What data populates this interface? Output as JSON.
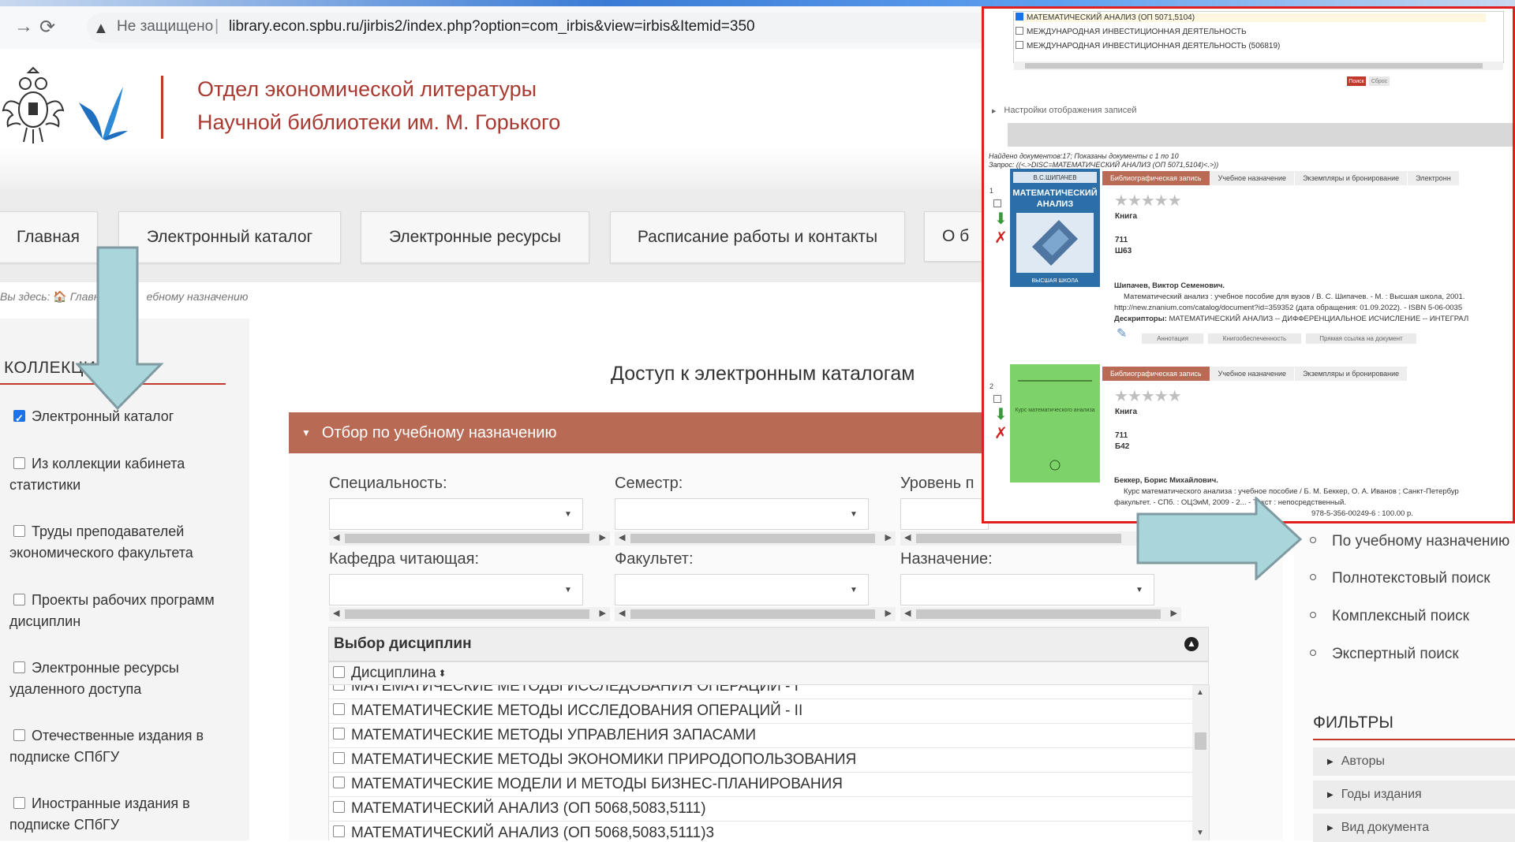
{
  "browser": {
    "insecure_label": "Не защищено",
    "url": "library.econ.spbu.ru/jirbis2/index.php?option=com_irbis&view=irbis&Itemid=350",
    "back_icon": "arrow-forward-icon",
    "reload_icon": "reload-icon"
  },
  "header": {
    "title_line1": "Отдел экономической литературы",
    "title_line2": "Научной библиотеки им. М. Горького"
  },
  "menu": [
    {
      "label": "Главная"
    },
    {
      "label": "Электронный каталог"
    },
    {
      "label": "Электронные ресурсы"
    },
    {
      "label": "Расписание работы и контакты"
    },
    {
      "label": "О б"
    }
  ],
  "breadcrumb": {
    "prefix": "Вы здесь:",
    "home": "Главная",
    "current": "ебному назначению"
  },
  "sidebar": {
    "heading": "КОЛЛЕКЦИИ",
    "items": [
      {
        "label": "Электронный каталог",
        "checked": true
      },
      {
        "label": "Из коллекции кабинета статистики",
        "checked": false
      },
      {
        "label": "Труды преподавателей экономического факультета",
        "checked": false
      },
      {
        "label": "Проекты рабочих программ дисциплин",
        "checked": false
      },
      {
        "label": "Электронные ресурсы удаленного доступа",
        "checked": false
      },
      {
        "label": "Отечественные издания в подписке СПбГУ",
        "checked": false
      },
      {
        "label": "Иностранные издания в подписке СПбГУ",
        "checked": false
      }
    ]
  },
  "main": {
    "title": "Доступ к электронным каталогам",
    "panel_title": "Отбор по учебному назначению",
    "fields": {
      "specialty": "Специальность:",
      "semester": "Семестр:",
      "level": "Уровень п",
      "department": "Кафедра читающая:",
      "faculty": "Факультет:",
      "purpose": "Назначение:"
    },
    "disciplines": {
      "heading": "Выбор дисциплин",
      "column": "Дисциплина",
      "rows": [
        "МАТЕМАТИЧЕСКИЕ МЕТОДЫ ИССЛЕДОВАНИЯ ОПЕРАЦИЙ - I",
        "МАТЕМАТИЧЕСКИЕ МЕТОДЫ ИССЛЕДОВАНИЯ ОПЕРАЦИЙ - II",
        "МАТЕМАТИЧЕСКИЕ МЕТОДЫ УПРАВЛЕНИЯ ЗАПАСАМИ",
        "МАТЕМАТИЧЕСКИЕ МЕТОДЫ ЭКОНОМИКИ ПРИРОДОПОЛЬЗОВАНИЯ",
        "МАТЕМАТИЧЕСКИЕ МОДЕЛИ И МЕТОДЫ БИЗНЕС-ПЛАНИРОВАНИЯ",
        "МАТЕМАТИЧЕСКИЙ АНАЛИЗ (ОП 5068,5083,5111)",
        "МАТЕМАТИЧЕСКИЙ АНАЛИЗ (ОП 5068,5083,5111)3"
      ]
    }
  },
  "right_sidebar": {
    "search_links": [
      "По учебному назначению",
      "Полнотекстовый поиск",
      "Комплексный поиск",
      "Экспертный поиск"
    ],
    "filters_heading": "ФИЛЬТРЫ",
    "filters": [
      "Авторы",
      "Годы издания",
      "Вид документа"
    ]
  },
  "inset": {
    "list_rows": [
      {
        "label": "МАТЕМАТИЧЕСКИЙ АНАЛИЗ (ОП 5071,5104)",
        "checked": true
      },
      {
        "label": "МЕЖДУНАРОДНАЯ ИНВЕСТИЦИОННАЯ ДЕЯТЕЛЬНОСТЬ",
        "checked": false
      },
      {
        "label": "МЕЖДУНАРОДНАЯ ИНВЕСТИЦИОННАЯ ДЕЯТЕЛЬНОСТЬ (506819)",
        "checked": false
      }
    ],
    "btn_search": "Поиск",
    "btn_reset": "Сброс",
    "display_settings": "Настройки отображения записей",
    "found_line1": "Найдено документов:17; Показаны документы с 1 по 10",
    "found_line2": "Запрос: ((<.>DISC=МАТЕМАТИЧЕСКИЙ АНАЛИЗ (ОП 5071,5104)<.>))",
    "tabs1": [
      "Библиографическая запись",
      "Учебное назначение",
      "Экземпляры и бронирование",
      "Электронн"
    ],
    "tabs2": [
      "Библиографическая запись",
      "Учебное назначение",
      "Экземпляры и бронирование"
    ],
    "record1": {
      "num": "1",
      "cover_author": "В.С.ШИПАЧЕВ",
      "cover_title1": "МАТЕМАТИЧЕСКИЙ",
      "cover_title2": "АНАЛИЗ",
      "cover_publisher": "ВЫСШАЯ ШКОЛА",
      "doc_type": "Книга",
      "code1": "711",
      "code2": "Ш63",
      "author": "Шипачев, Виктор Семенович.",
      "desc1": "Математический анализ : учебное пособие для вузов / В. С. Шипачев. - М. : Высшая школа, 2001.",
      "desc2": "http://new.znanium.com/catalog/document?id=359352 (дата обращения: 01.09.2022). - ISBN 5-06-0035",
      "desc3_label": "Дескрипторы:",
      "desc3": "МАТЕМАТИЧЕСКИЙ АНАЛИЗ -- ДИФФЕРЕНЦИАЛЬНОЕ ИСЧИСЛЕНИЕ -- ИНТЕГРАЛ",
      "btns": [
        "Аннотация",
        "Книгообеспеченность",
        "Прямая ссылка на документ"
      ]
    },
    "record2": {
      "num": "2",
      "cover_title": "Курс математического анализа",
      "doc_type": "Книга",
      "code1": "711",
      "code2": "Б42",
      "author": "Беккер, Борис Михайлович.",
      "desc1": "Курс математического анализа : учебное пособие / Б. М. Беккер, О. А. Иванов ; Санкт-Петербур",
      "desc2": "факультет. - СПб. : ОЦЭиМ, 2009 - 2... - Текст : непосредственный.",
      "desc3": "978-5-356-00249-6 : 100.00 р."
    }
  },
  "colors": {
    "accent": "#c0392b",
    "panel": "#b86a55",
    "arrow": "#a9d6db",
    "inset_border": "#e02020"
  }
}
